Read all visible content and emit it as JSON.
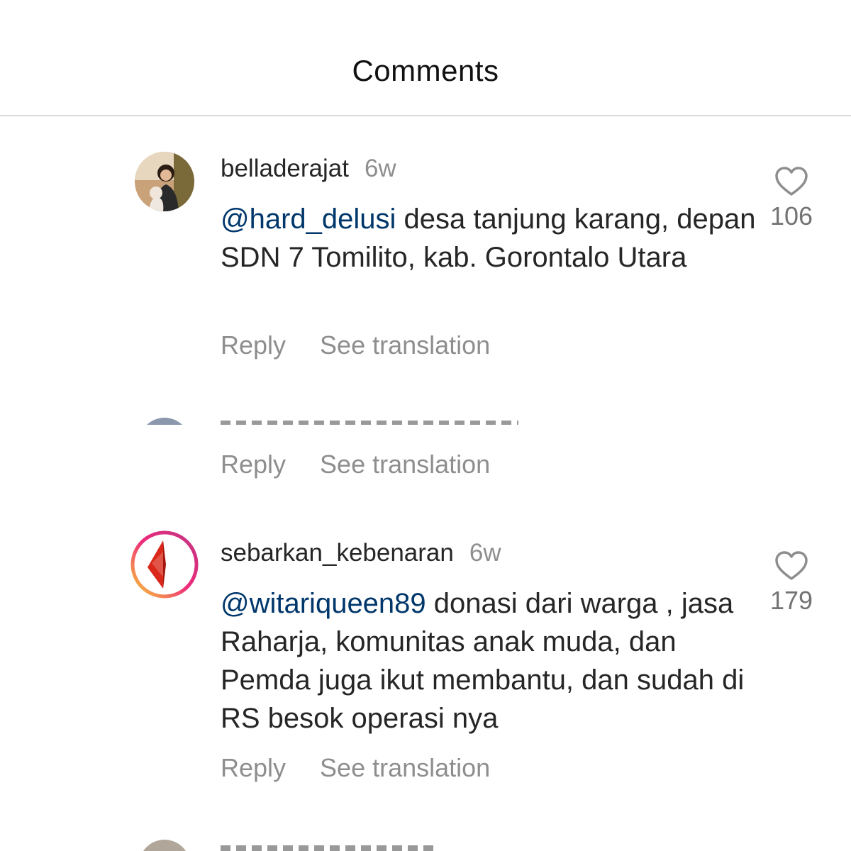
{
  "header": {
    "title": "Comments"
  },
  "comments": [
    {
      "username": "belladerajat",
      "time": "6w",
      "mention": "@hard_delusi",
      "text": " desa tanjung karang, depan SDN 7 Tomilito, kab. Gorontalo Utara",
      "reply_label": "Reply",
      "translate_label": "See translation",
      "likes": "106"
    },
    {
      "username": "",
      "time": "",
      "reply_label": "Reply",
      "translate_label": "See translation"
    },
    {
      "username": "sebarkan_kebenaran",
      "time": "6w",
      "mention": "@witariqueen89",
      "text": " donasi dari warga , jasa Raharja, komunitas anak muda, dan Pemda juga ikut membantu, dan sudah di RS besok operasi nya",
      "reply_label": "Reply",
      "translate_label": "See translation",
      "likes": "179"
    }
  ],
  "colors": {
    "mention": "#00376b",
    "secondary_text": "#8e8e8e",
    "story_ring_start": "#f9ce34",
    "story_ring_mid": "#ee2a7b",
    "story_ring_end": "#6228d7"
  },
  "icons": {
    "like": "heart-outline-icon"
  }
}
